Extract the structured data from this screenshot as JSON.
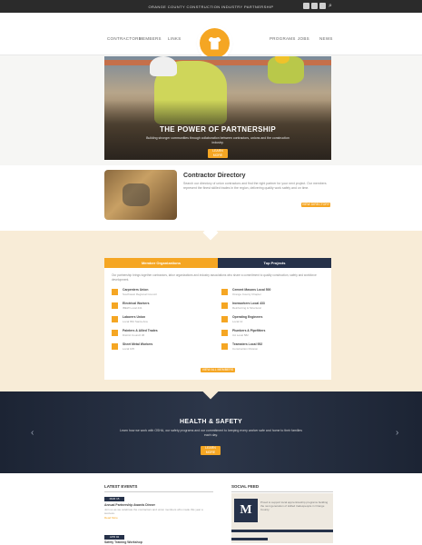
{
  "topbar": {
    "text": "ORANGE COUNTY CONSTRUCTION INDUSTRY PARTNERSHIP"
  },
  "nav": {
    "items": [
      "Contractors",
      "Members",
      "Links",
      "Programs",
      "Jobs",
      "News"
    ]
  },
  "hero": {
    "title": "THE POWER OF PARTNERSHIP",
    "subtitle": "Building stronger communities through collaboration between contractors, unions and the construction industry.",
    "button": "Learn More"
  },
  "directory": {
    "title": "Contractor Directory",
    "text": "Search our directory of union contractors and find the right partner for your next project. Our members represent the finest skilled trades in the region, delivering quality work safely and on time.",
    "button": "View Directory"
  },
  "tabs": {
    "active": "Member Organizations",
    "inactive": "Top Projects"
  },
  "panel": {
    "intro": "Our partnership brings together contractors, labor organizations and industry associations who share a commitment to quality construction, safety and workforce development.",
    "orgs": [
      {
        "name": "Carpenters Union",
        "desc": "Southwest Regional Council"
      },
      {
        "name": "Cement Masons Local 500",
        "desc": "Orange County Chapter"
      },
      {
        "name": "Electrical Workers",
        "desc": "IBEW Local 441"
      },
      {
        "name": "Ironworkers Local 433",
        "desc": "Reinforcing & Structural"
      },
      {
        "name": "Laborers Union",
        "desc": "Local 652 Santa Ana"
      },
      {
        "name": "Operating Engineers",
        "desc": "Local 12"
      },
      {
        "name": "Painters & Allied Trades",
        "desc": "District Council 36"
      },
      {
        "name": "Plumbers & Pipefitters",
        "desc": "UA Local 582"
      },
      {
        "name": "Sheet Metal Workers",
        "desc": "Local 105"
      },
      {
        "name": "Teamsters Local 952",
        "desc": "Construction Division"
      }
    ],
    "button": "View All Members"
  },
  "safety": {
    "title": "HEALTH & SAFETY",
    "subtitle": "Learn how we work with OSHA, our safety programs and our commitment to keeping every worker safe and home to their families each day.",
    "button": "Learn More",
    "prev_icon": "‹",
    "next_icon": "›"
  },
  "events": {
    "title": "LATEST EVENTS",
    "items": [
      {
        "date": "MAR 15",
        "title": "Annual Partnership Awards Dinner",
        "desc": "Join us as we celebrate the contractors and union members who made this year a success.",
        "more": "Read More"
      },
      {
        "date": "APR 02",
        "title": "Safety Training Workshop",
        "desc": "",
        "more": ""
      }
    ]
  },
  "social": {
    "title": "SOCIAL FEED",
    "logo_letter": "M",
    "text": "Proud to support local apprenticeship programs building the next generation of skilled tradespeople in Orange County."
  },
  "colors": {
    "accent": "#f5a623",
    "navy": "#26324a",
    "cream": "#f8ecd7"
  }
}
